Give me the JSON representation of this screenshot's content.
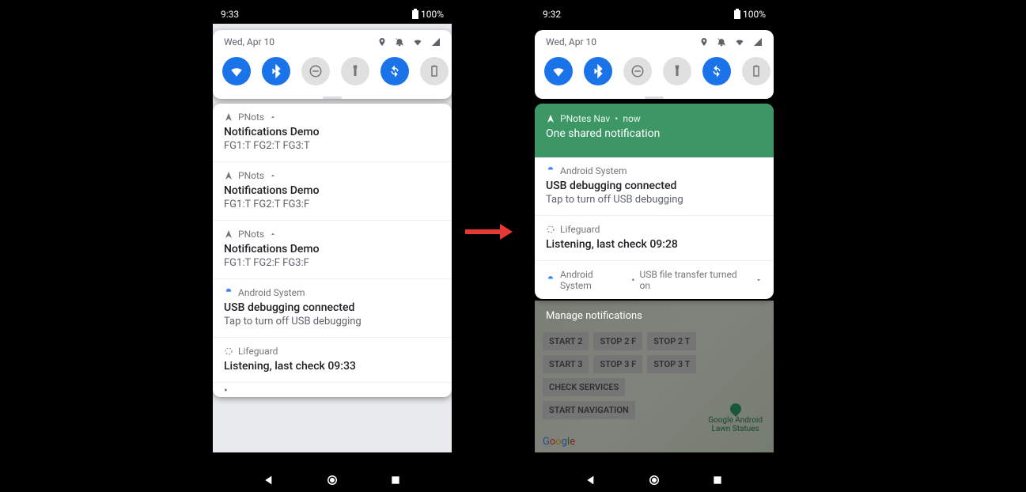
{
  "left": {
    "status": {
      "time": "9:33",
      "battery": "100%"
    },
    "date": "Wed, Apr 10",
    "qs": [
      {
        "name": "wifi",
        "on": true
      },
      {
        "name": "bluetooth",
        "on": true
      },
      {
        "name": "dnd",
        "on": false
      },
      {
        "name": "flashlight",
        "on": false
      },
      {
        "name": "rotate",
        "on": true
      },
      {
        "name": "battery-saver",
        "on": false
      }
    ],
    "notifs": [
      {
        "app": "PNots",
        "caret": true,
        "title": "Notifications Demo",
        "body": "FG1:T FG2:T FG3:T",
        "icon": "nav"
      },
      {
        "app": "PNots",
        "caret": true,
        "title": "Notifications Demo",
        "body": "FG1:T FG2:T FG3:F",
        "icon": "nav"
      },
      {
        "app": "PNots",
        "caret": true,
        "title": "Notifications Demo",
        "body": "FG1:T FG2:F FG3:F",
        "icon": "nav"
      },
      {
        "app": "Android System",
        "title": "USB debugging connected",
        "body": "Tap to turn off USB debugging",
        "icon": "android"
      },
      {
        "app": "Lifeguard",
        "title": "Listening, last check 09:33",
        "icon": "lifeguard"
      }
    ]
  },
  "right": {
    "status": {
      "time": "9:32",
      "battery": "100%"
    },
    "date": "Wed, Apr 10",
    "qs": [
      {
        "name": "wifi",
        "on": true
      },
      {
        "name": "bluetooth",
        "on": true
      },
      {
        "name": "dnd",
        "on": false
      },
      {
        "name": "flashlight",
        "on": false
      },
      {
        "name": "rotate",
        "on": true
      },
      {
        "name": "battery-saver",
        "on": false
      }
    ],
    "green": {
      "app": "PNotes Nav",
      "time": "now",
      "title": "One shared notification"
    },
    "notifs": [
      {
        "app": "Android System",
        "title": "USB debugging connected",
        "body": "Tap to turn off USB debugging",
        "icon": "android"
      },
      {
        "app": "Lifeguard",
        "title": "Listening, last check 09:28",
        "icon": "lifeguard"
      }
    ],
    "collapsed": {
      "app": "Android System",
      "text": "USB file transfer turned on"
    },
    "manage": "Manage notifications",
    "map_buttons": [
      "START 2",
      "STOP 2 F",
      "STOP 2 T",
      "START 3",
      "STOP 3 F",
      "STOP 3 T",
      "CHECK SERVICES",
      "START NAVIGATION"
    ],
    "poi": "Google Android\nLawn Statues",
    "google": "Google"
  }
}
